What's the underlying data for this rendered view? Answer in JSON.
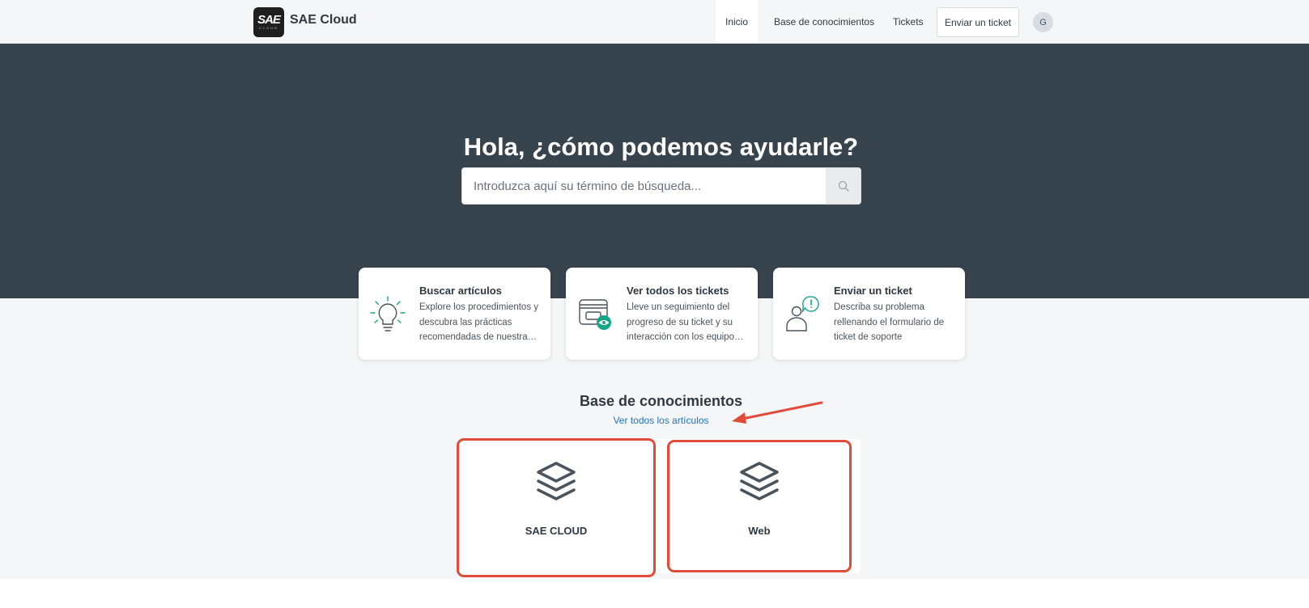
{
  "header": {
    "logo_text": "SAE",
    "logo_subtext": "CLOUD",
    "brand": "SAE Cloud",
    "nav": {
      "home": "Inicio",
      "knowledge_base": "Base de conocimientos",
      "tickets": "Tickets",
      "submit_ticket": "Enviar un ticket"
    },
    "avatar_initial": "G"
  },
  "hero": {
    "title": "Hola, ¿cómo podemos ayudarle?",
    "search_placeholder": "Introduzca aquí su término de búsqueda...",
    "search_icon": "search-icon"
  },
  "cards": [
    {
      "icon": "lightbulb-icon",
      "title": "Buscar artículos",
      "description": "Explore los procedimientos y descubra las prácticas recomendadas de nuestra…"
    },
    {
      "icon": "ticket-view-icon",
      "title": "Ver todos los tickets",
      "description": "Lleve un seguimiento del progreso de su ticket y su interacción con los equipo…"
    },
    {
      "icon": "person-alert-icon",
      "title": "Enviar un ticket",
      "description": "Describa su problema rellenando el formulario de ticket de soporte"
    }
  ],
  "knowledge_base": {
    "title": "Base de conocimientos",
    "view_all": "Ver todos los artículos",
    "categories": [
      {
        "icon": "layers-icon",
        "label": "SAE CLOUD"
      },
      {
        "icon": "layers-icon",
        "label": "Web"
      }
    ]
  },
  "colors": {
    "hero_bg": "#37434d",
    "accent_green": "#17a589",
    "link_blue": "#1f73b7",
    "annotation_red": "#e04b3a"
  }
}
